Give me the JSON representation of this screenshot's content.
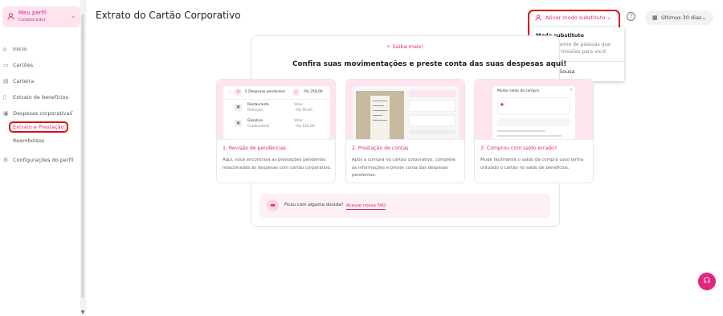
{
  "profile": {
    "name": "Meu perfil",
    "role": "Colaborador",
    "avatar_icon": "user-icon"
  },
  "sidebar": {
    "items": [
      {
        "label": "Início",
        "icon": "home-icon"
      },
      {
        "label": "Cartões",
        "icon": "card-icon"
      },
      {
        "label": "Carteira",
        "icon": "wallet-icon"
      },
      {
        "label": "Extrato de benefícios",
        "icon": "receipt-icon"
      },
      {
        "label": "Despesas corporativas",
        "icon": "briefcase-icon"
      },
      {
        "label": "Extrato e Prestação"
      },
      {
        "label": "Reembolsos"
      },
      {
        "label": "Configurações do perfil",
        "icon": "gear-icon"
      }
    ]
  },
  "page": {
    "title": "Extrato do Cartão Corporativo"
  },
  "header": {
    "substitute_label": "Ativar modo substituto",
    "period_label": "Últimos 30 dias"
  },
  "dropdown": {
    "title": "Modo substituto",
    "description": "Atue em nome de pessoas que deram permissões para você",
    "user": "Amanda Sousa"
  },
  "intro": {
    "saiba_label": "Saiba mais!",
    "heading": "Confira suas movimentações e preste conta das suas despesas aqui!"
  },
  "steps": [
    {
      "title": "1. Revisão de pendências",
      "text": "Aqui, você encontrará as prestações pendentes relacionadas às despesas com cartão corporativo."
    },
    {
      "title": "2. Prestação de contas",
      "text": "Após a compra no cartão corporativo, complete as informações e preste conta das despesas pendentes."
    },
    {
      "title": "3. Comprou com saldo errado?",
      "text": "Mude facilmente o saldo da compra caso tenha utilizado o cartão no saldo de benefícios."
    }
  ],
  "mock1": {
    "header": "5 Despesas pendentes",
    "total": "- R$ 250,00",
    "rows": [
      {
        "name": "Restaurante",
        "cat": "Refeição",
        "vlabel": "Valor",
        "value": "- R$ 50,00"
      },
      {
        "name": "Gasolina",
        "cat": "Combustível",
        "vlabel": "Valor",
        "value": "- R$ 150,00"
      }
    ]
  },
  "mock3": {
    "title": "Mudar saldo da compra"
  },
  "faq": {
    "question": "Ficou com alguma dúvida?",
    "link": "Acesse nossa FAQ"
  },
  "colors": {
    "accent": "#e0267e",
    "accent_light": "#fde4ef",
    "highlight": "#dd1111"
  }
}
